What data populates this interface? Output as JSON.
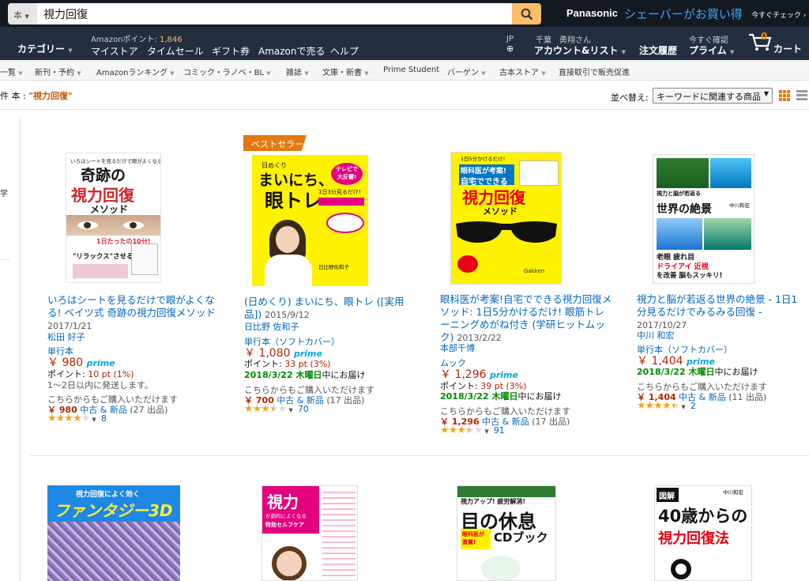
{
  "header": {
    "search_category": "本",
    "search_query": "視力回復",
    "promo_brand": "Panasonic",
    "promo_text": "シェーバーがお買い得",
    "promo_sub": "今すぐチェック ›"
  },
  "nav": {
    "category": "カテゴリー",
    "points_label": "Amazonポイント: ",
    "points_value": "1,846",
    "my_store": "マイストア",
    "time_sale": "タイムセール",
    "gift": "ギフト券",
    "sell": "Amazonで売る",
    "help": "ヘルプ",
    "lang": "JP",
    "greeting": "千葉　勇翔さん",
    "account": "アカウント&リスト",
    "orders": "注文履歴",
    "prime_top": "今すぐ確認",
    "prime": "プライム",
    "cart_count": "0",
    "cart": "カート"
  },
  "subnav": [
    "一覧",
    "新刊・予約",
    "Amazonランキング",
    "コミック・ラノベ・BL",
    "雑誌",
    "文庫・新書",
    "Prime Student",
    "バーゲン",
    "古本ストア",
    "直接取引で販売促進"
  ],
  "results": {
    "prefix": "件 本 : ",
    "query": "\"視力回復\"",
    "sort_label": "並べ替え:",
    "sort_value": "キーワードに関連する商品"
  },
  "left_glyph": "学",
  "products": [
    {
      "title": "いろはシートを見るだけで眼がよくなる! ベイツ式 奇跡の視力回復メソッド",
      "date": "2017/1/21",
      "author": "松田 好子",
      "format": "単行本",
      "price": "￥ 980",
      "prime": "prime",
      "points": "ポイント: ",
      "points_val": "10 pt (1%)",
      "ship": "1～2日以内に発送します。",
      "other": "こちらからもご購入いただけます",
      "used_price": "￥ 980",
      "used_text": "中古 & 新品",
      "used_count": "(27 出品)",
      "reviews": "8",
      "rating": 4,
      "cover": {
        "t1": "いろはシートを見るだけで眼がよくなる!",
        "t2": "奇跡の",
        "t3": "視力回復",
        "t4": "メソッド",
        "t5": "1日たったの10分!",
        "t6": "\"リラックス\"させる"
      }
    },
    {
      "badge": "ベストセラー",
      "title": "(日めくり) まいにち、眼トレ ([実用品])",
      "date": "2015/9/12",
      "author": "日比野 佐和子",
      "format": "単行本（ソフトカバー）",
      "price": "￥ 1,080",
      "prime": "prime",
      "points": "ポイント: ",
      "points_val": "33 pt (3%)",
      "delivery": "2018/3/22 木曜日",
      "delivery_suffix": "中にお届け",
      "other": "こちらからもご購入いただけます",
      "used_price": "￥ 700",
      "used_text": "中古 & 新品",
      "used_count": "(17 出品)",
      "reviews": "70",
      "rating": 3.5,
      "cover": {
        "t1": "日めくり",
        "t2": "まいにち、",
        "t3": "眼トレ",
        "t4": "1日3分見るだけ!",
        "t5": "テレビで大反響!",
        "t6": "日比野佐和子"
      }
    },
    {
      "title": "眼科医が考案!自宅でできる視力回復メソッド: 1日5分かけるだけ! 眼筋トレーニングめがね付き (学研ヒットムック)",
      "date": "2013/2/22",
      "author": "本部千博",
      "format": "ムック",
      "price": "￥ 1,296",
      "prime": "prime",
      "points": "ポイント: ",
      "points_val": "39 pt (3%)",
      "delivery": "2018/3/22 木曜日",
      "delivery_suffix": "中にお届け",
      "other": "こちらからもご購入いただけます",
      "used_price": "￥ 1,296",
      "used_text": "中古 & 新品",
      "used_count": "(17 出品)",
      "reviews": "91",
      "rating": 3.5,
      "cover": {
        "t1": "1日5分かけるだけ!",
        "t2": "眼科医が考案!",
        "t3": "自宅でできる",
        "t4": "視力回復",
        "t5": "メソッド",
        "t6": "Gakken"
      }
    },
    {
      "title": "視力と脳が若返る世界の絶景 - 1日1分見るだけでみるみる回復 -",
      "date": "2017/10/27",
      "author": "中川 和宏",
      "format": "単行本（ソフトカバー）",
      "price": "￥ 1,404",
      "prime": "prime",
      "delivery": "2018/3/22 木曜日",
      "delivery_suffix": "中にお届け",
      "other": "こちらからもご購入いただけます",
      "used_price": "￥ 1,404",
      "used_text": "中古 & 新品",
      "used_count": "(11 出品)",
      "reviews": "2",
      "rating": 4.5,
      "cover": {
        "t1": "視力と脳が若返る",
        "t2": "世界の絶景",
        "t3": "老眼 疲れ目",
        "t4": "ドライアイ 近視",
        "t5": "を改善 脳もスッキリ!",
        "t6": "中川和宏"
      }
    }
  ],
  "row2": [
    {
      "t1": "視力回復によく効く",
      "t2": "ファンタジー3D"
    },
    {
      "t1": "視力",
      "t2": "が劇的によくなる",
      "t3": "特効セルフケア"
    },
    {
      "t1": "視力アップ! 疲労解消!",
      "t2": "目の休息",
      "t3": "CDブック",
      "t4": "眼科医が激賞!"
    },
    {
      "t1": "図解",
      "t2": "40歳からの",
      "t3": "視力回復法",
      "t4": "中川和宏"
    }
  ],
  "colors": {
    "accent": "#febd69",
    "topbar": "#131921",
    "navbar": "#232f3e",
    "link": "#0066c0",
    "price": "#b12704"
  }
}
